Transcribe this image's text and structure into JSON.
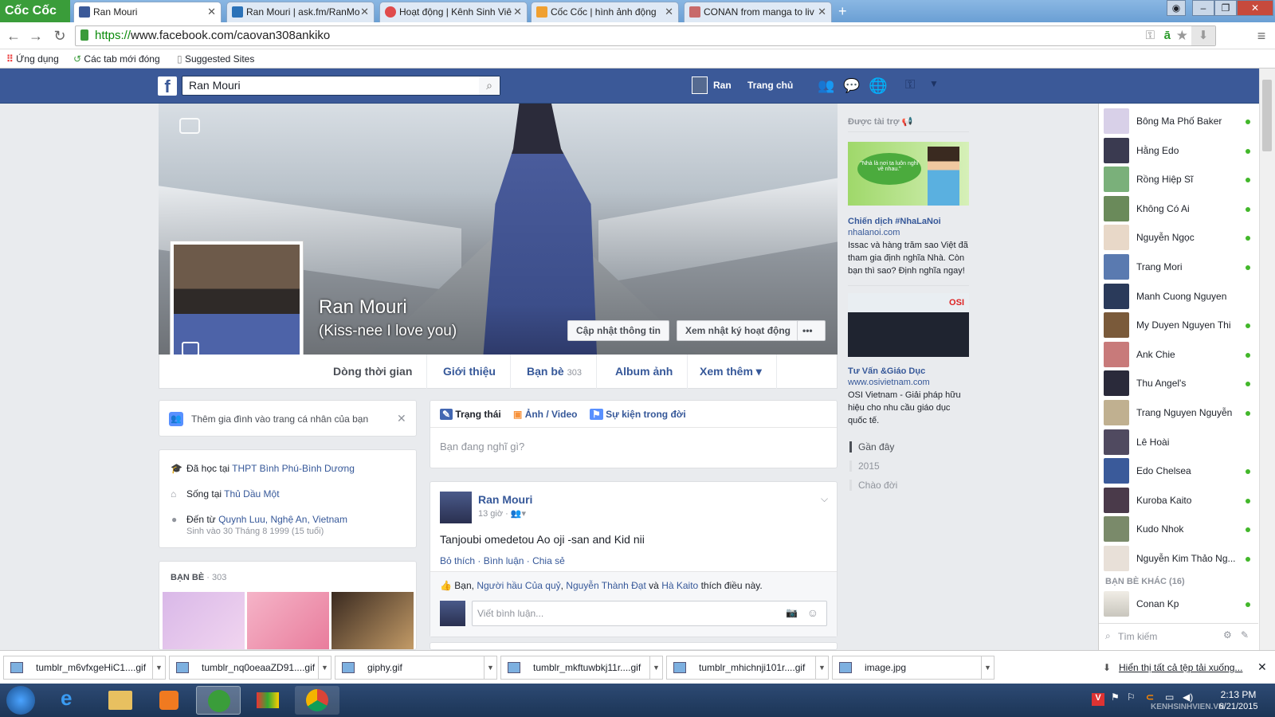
{
  "browser": {
    "brand": "Cốc Cốc",
    "tabs": [
      {
        "title": "Ran Mouri",
        "active": true
      },
      {
        "title": "Ran Mouri | ask.fm/RanMo"
      },
      {
        "title": "Hoạt động | Kênh Sinh Viê"
      },
      {
        "title": "Cốc Cốc | hình ảnh động"
      },
      {
        "title": "CONAN from manga to liv"
      }
    ],
    "url_scheme": "https://",
    "url_rest": "www.facebook.com/caovan308ankiko",
    "bookmarks": [
      "Ứng dụng",
      "Các tab mới đóng",
      "Suggested Sites"
    ]
  },
  "fb": {
    "search_value": "Ran Mouri",
    "header_user": "Ran",
    "header_home": "Trang chủ",
    "profile": {
      "name": "Ran Mouri",
      "nickname": "(Kiss-nee I love you)",
      "btn_update": "Cập nhật thông tin",
      "btn_activity": "Xem nhật ký hoạt động",
      "btn_more": "•••"
    },
    "tabs": [
      {
        "label": "Dòng thời gian"
      },
      {
        "label": "Giới thiệu"
      },
      {
        "label": "Bạn bè",
        "count": "303"
      },
      {
        "label": "Album ảnh"
      },
      {
        "label": "Xem thêm ▾"
      }
    ],
    "family_prompt": "Thêm gia đình vào trang cá nhân của bạn",
    "intro": {
      "studied_prefix": "Đã học tại",
      "studied_link": "THPT Bình Phú-Bình Dương",
      "lives_prefix": "Sống tại",
      "lives_link": "Thủ Dầu Một",
      "from_prefix": "Đến từ",
      "from_link": "Quynh Luu, Nghệ An, Vietnam",
      "born": "Sinh vào 30 Tháng 8 1999 (15 tuổi)"
    },
    "friends_header": "BẠN BÈ",
    "friends_count": "· 303",
    "composer": {
      "status": "Trạng thái",
      "photo": "Ảnh / Video",
      "life_event": "Sự kiện trong đời",
      "placeholder": "Bạn đang nghĩ gì?"
    },
    "post": {
      "author": "Ran Mouri",
      "time": "13 giờ ·",
      "text": "Tanjoubi omedetou Ao oji -san and Kid nii",
      "like": "Bỏ thích",
      "comment": "Bình luận",
      "share": "Chia sẻ",
      "likes_you": "Bạn,",
      "likes_p1": "Người hầu Của quỷ",
      "likes_p2": "Nguyễn Thành Đạt",
      "likes_and": "và",
      "likes_p3": "Hà Kaito",
      "likes_suffix": "thích điều này.",
      "comment_placeholder": "Viết bình luận..."
    },
    "sponsor": {
      "header": "Được tài trợ",
      "ad1_title": "Chiến dịch #NhaLaNoi",
      "ad1_domain": "nhalanoi.com",
      "ad1_text": "Issac và hàng trăm sao Việt đã tham gia định nghĩa Nhà. Còn bạn thì sao? Định nghĩa ngay!",
      "ad1_img_text": "\"Nhà là nơi ta luôn nghĩ về nhau.\"",
      "ad2_title": "Tư Vấn &Giáo Dục",
      "ad2_domain": "www.osivietnam.com",
      "ad2_text": "OSI Vietnam - Giải pháp hữu hiệu cho nhu cầu giáo dục quốc tế.",
      "ad2_logo": "OSI",
      "timeline": [
        "Gần đây",
        "2015",
        "Chào đời"
      ]
    },
    "chat": {
      "online": [
        "Bông Ma Phố Baker",
        "Hằng Edo",
        "Rồng Hiệp Sĩ",
        "Không Có Ai",
        "Nguyễn Ngọc",
        "Trang Mori",
        "Manh Cuong Nguyen",
        "My Duyen Nguyen Thi",
        "Ank Chie",
        "Thu Angel's",
        "Trang Nguyen Nguyễn",
        "Lê Hoài",
        "Edo Chelsea",
        "Kuroba Kaito",
        "Kudo Nhok",
        "Nguyễn Kim Thảo Ng..."
      ],
      "online_dot": [
        true,
        true,
        true,
        true,
        true,
        true,
        false,
        true,
        true,
        true,
        true,
        false,
        true,
        true,
        true,
        true
      ],
      "other_header": "BẠN BÈ KHÁC (16)",
      "other": [
        "Conan Kp"
      ],
      "search_placeholder": "Tìm kiếm"
    }
  },
  "downloads": {
    "files": [
      "tumblr_m6vfxgeHiC1....gif",
      "tumblr_nq0oeaaZD91....gif",
      "giphy.gif",
      "tumblr_mkftuwbkj11r....gif",
      "tumblr_mhichnji101r....gif",
      "image.jpg"
    ],
    "show_all": "Hiển thị tất cả tệp tải xuống..."
  },
  "taskbar": {
    "time": "2:13 PM",
    "date": "6/21/2015",
    "watermark": "KENHSINHVIEN.VN"
  }
}
